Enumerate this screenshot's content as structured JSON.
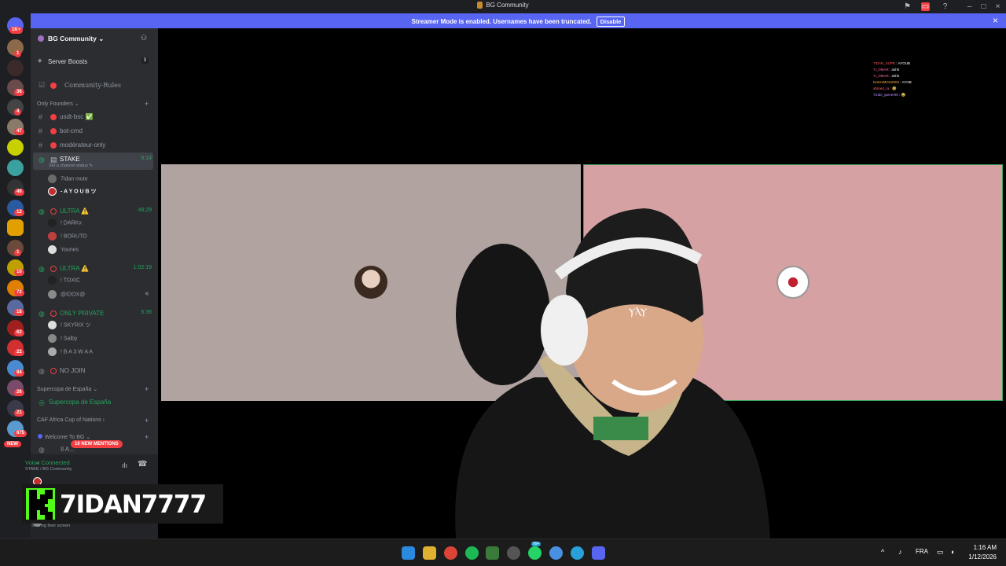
{
  "window": {
    "title": "BG Community"
  },
  "banner": {
    "message": "Streamer Mode is enabled. Usernames have been truncated.",
    "disable_label": "Disable",
    "close": "×"
  },
  "rail": {
    "home_badge": "1K+",
    "badges": [
      "1",
      "36",
      "4",
      "47",
      "40",
      "12",
      "1",
      "10",
      "72",
      "18",
      "62",
      "22",
      "84",
      "26",
      "21",
      "675"
    ],
    "new_label": "NEW"
  },
  "guild": {
    "name": "BG Community ⌄"
  },
  "sidebar": {
    "boosts_label": "Server Boosts",
    "boosts_count": "3",
    "rules_label": "Community-Rules",
    "cat_founders": "Only Founders ⌄",
    "channels": [
      {
        "label": "usdt-bsc ✅"
      },
      {
        "label": "bot-cmd"
      },
      {
        "label": "modérateur-only"
      }
    ],
    "stake": {
      "label": "STAKE",
      "time": "9:14",
      "status": "Set a channel status ✎"
    },
    "stake_users": [
      "7idan mute",
      "- A Y O U B ツ"
    ],
    "ultra1": {
      "label": "ULTRA ⚠️",
      "time": "48:29"
    },
    "ultra1_users": [
      "! DARKx",
      "! BORUTO",
      "Younes"
    ],
    "ultra2": {
      "label": "ULTRA ⚠️",
      "time": "1:02:19"
    },
    "ultra2_users": [
      "! TOXIC",
      "@IDOX@"
    ],
    "private": {
      "label": "ONLY PRIVATE",
      "time": "5:36"
    },
    "private_users": [
      "! SKYRIX ツ",
      "! Salby",
      "! B A 3 W A A"
    ],
    "nojoin": {
      "label": "NO JOIN"
    },
    "cat_supercopa": "Supercopa de España ⌄",
    "supercopa_channel": "Supercopa de España",
    "cat_caf": "CAF Africa Cup of Nations ›",
    "cat_welcome": "Welcome To BG ⌄",
    "partial_channel": "Il A...",
    "mentions": "10 NEW MENTIONS"
  },
  "voice": {
    "status": "Voice Connected",
    "channel": "STAKE / BG Community",
    "sharing": "Sharing their screen"
  },
  "overlay": {
    "brand": "7IDAN7777"
  },
  "chat": [
    {
      "user": "7IDAN_SUPE",
      "msg": "AYOUB",
      "color": "#ff5555"
    },
    {
      "user": "7I_OMAR",
      "msg": "ashb",
      "color": "#ff6b9d"
    },
    {
      "user": "7I_OMAR",
      "msg": "ashb",
      "color": "#ff6b9d"
    },
    {
      "user": "NAKHMOH2003",
      "msg": "AYOB",
      "color": "#ffb347"
    },
    {
      "user": "ahmed_ra",
      "msg": "🤣",
      "color": "#ff6b6b"
    },
    {
      "user": "7izaki_gamer98",
      "msg": "😂",
      "color": "#b28dff"
    }
  ],
  "taskbar": {
    "lang": "FRA",
    "time": "1:16 AM",
    "date": "1/12/2026",
    "badge": "99+"
  }
}
